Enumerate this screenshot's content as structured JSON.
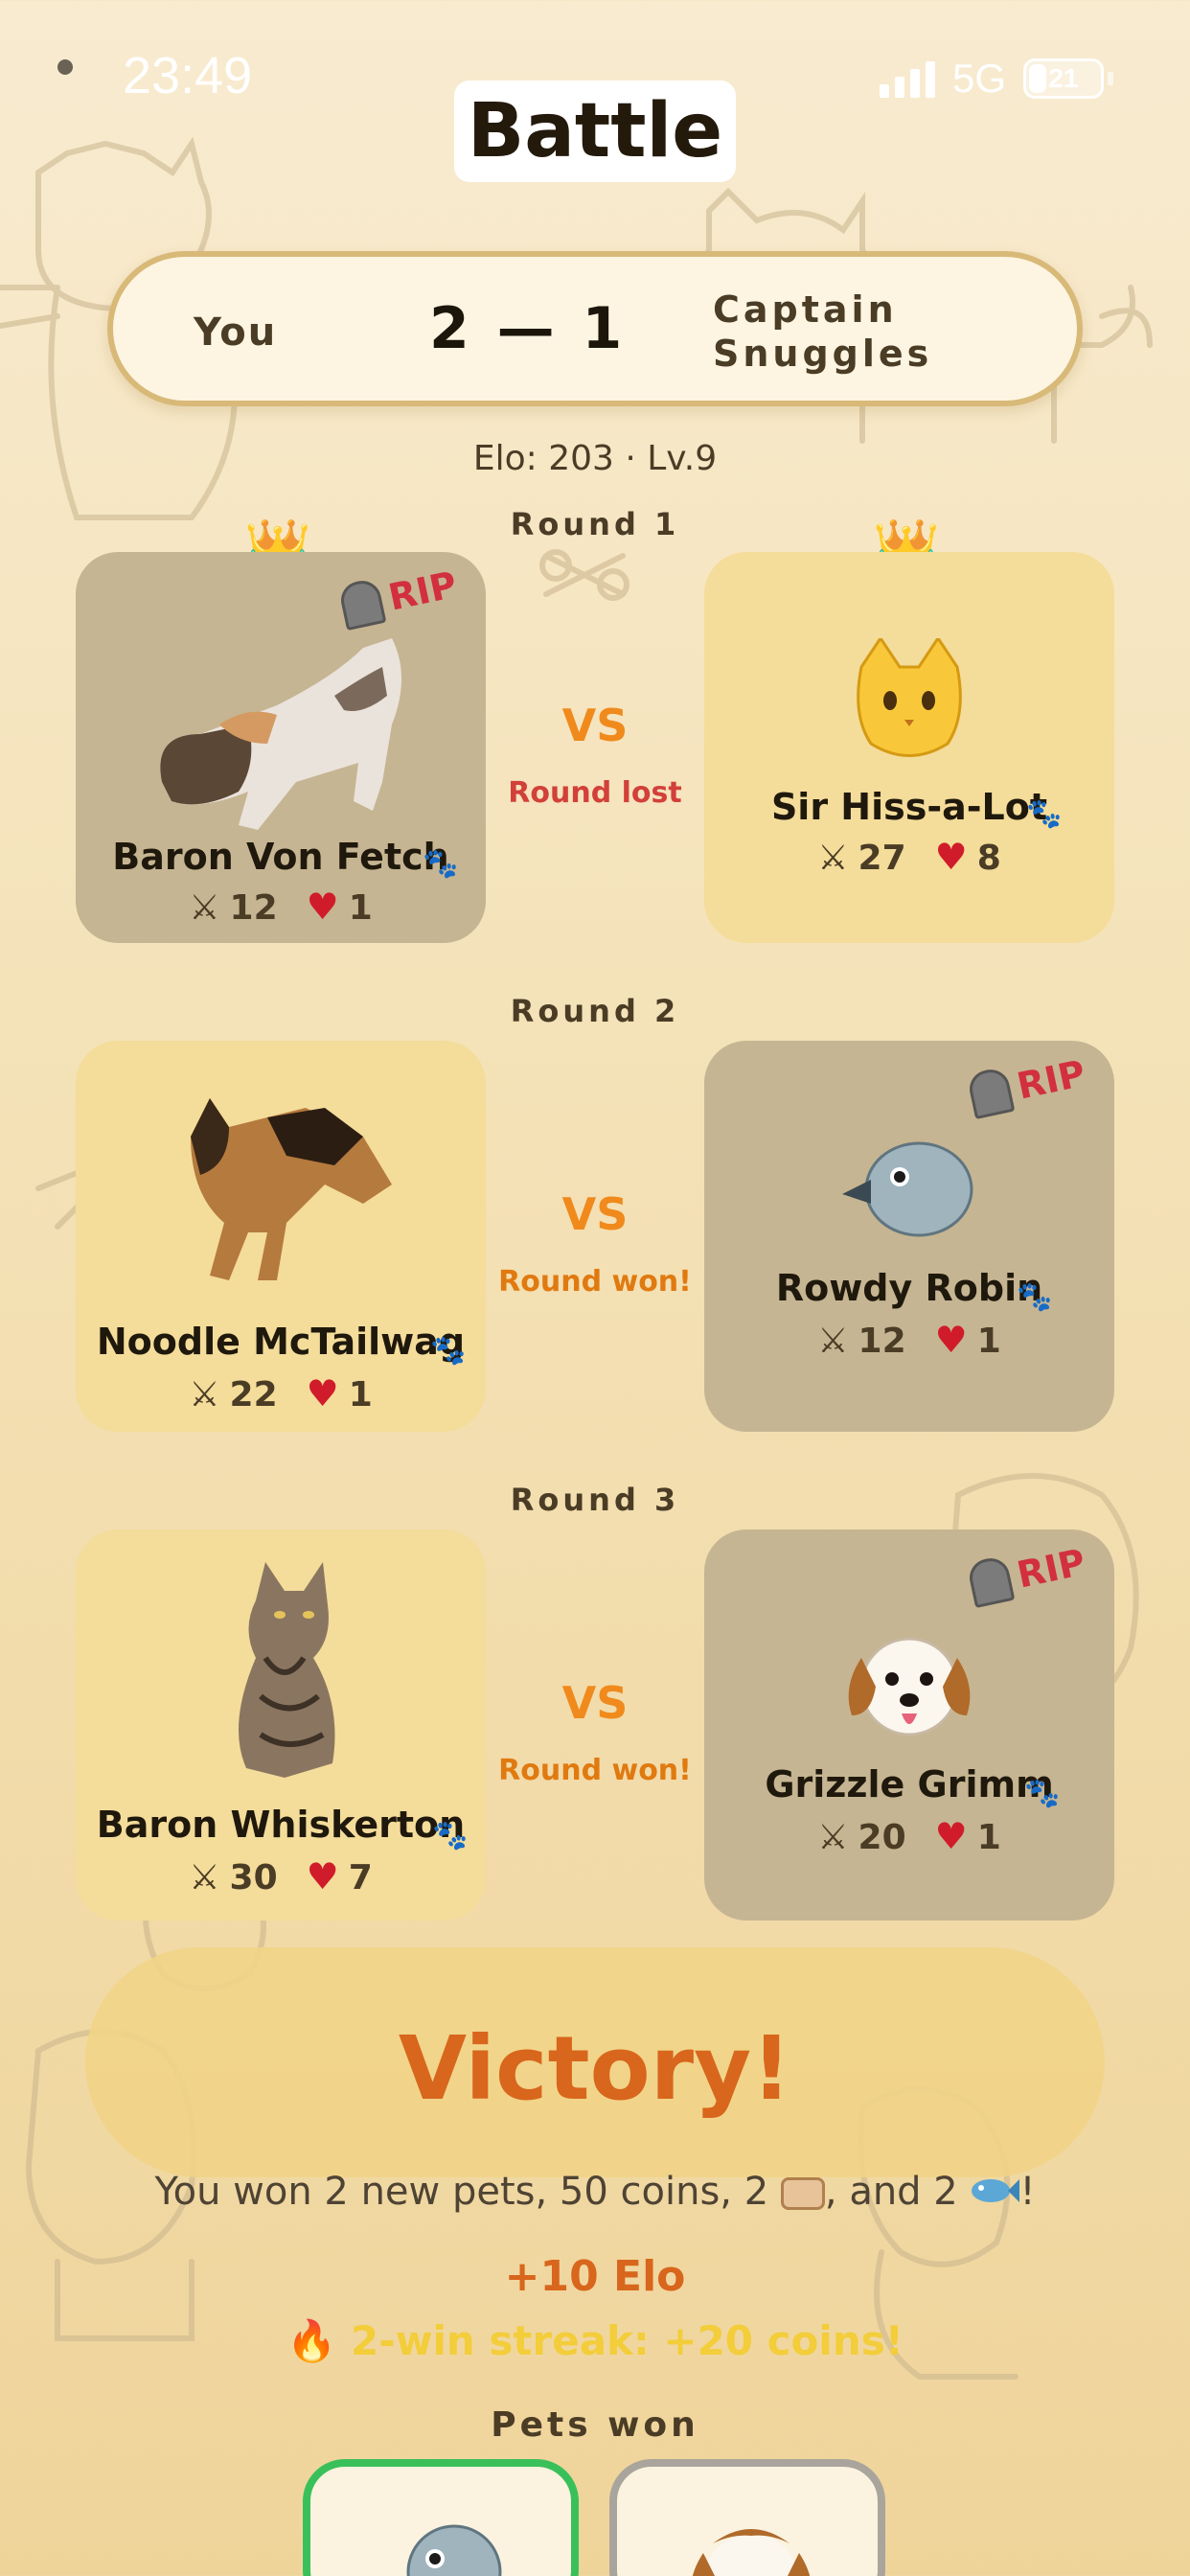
{
  "status": {
    "time": "23:49",
    "network": "5G",
    "battery": "21"
  },
  "title": "Battle",
  "score": {
    "you": "You",
    "value": "2 — 1",
    "opponent": "Captain Snuggles"
  },
  "opponent_info": "Elo: 203 · Lv.9",
  "rounds": [
    {
      "label": "Round 1",
      "result": "Round lost",
      "vs": "VS",
      "left": {
        "name": "Baron Von Fetch",
        "attack": "12",
        "hp": "1",
        "dead": true,
        "crown": true,
        "image": "calico-cat-photo"
      },
      "right": {
        "name": "Sir Hiss-a-Lot",
        "attack": "27",
        "hp": "8",
        "dead": false,
        "crown": true,
        "image": "cat-emoji"
      }
    },
    {
      "label": "Round 2",
      "result": "Round won!",
      "vs": "VS",
      "left": {
        "name": "Noodle McTailwag",
        "attack": "22",
        "hp": "1",
        "dead": false,
        "image": "german-shepherd-photo"
      },
      "right": {
        "name": "Rowdy Robin",
        "attack": "12",
        "hp": "1",
        "dead": true,
        "image": "bird-emoji"
      }
    },
    {
      "label": "Round 3",
      "result": "Round won!",
      "vs": "VS",
      "left": {
        "name": "Baron Whiskerton",
        "attack": "30",
        "hp": "7",
        "dead": false,
        "image": "tabby-cat-photo"
      },
      "right": {
        "name": "Grizzle Grimm",
        "attack": "20",
        "hp": "1",
        "dead": true,
        "image": "dog-emoji"
      }
    }
  ],
  "rip_label": "RIP",
  "victory": {
    "title": "Victory!",
    "reward_prefix": "You won 2 new pets, 50 coins, 2",
    "reward_mid": ", and 2",
    "reward_suffix": "!",
    "elo": "+10 Elo",
    "streak": "2-win streak: +20 coins!"
  },
  "pets_won_label": "Pets won",
  "colors": {
    "accent": "#f08a1c",
    "lost": "#d2403a",
    "won_border": "#3ac05a",
    "dead_card": "#c6b592",
    "alive_card": "#f4dc9a"
  }
}
